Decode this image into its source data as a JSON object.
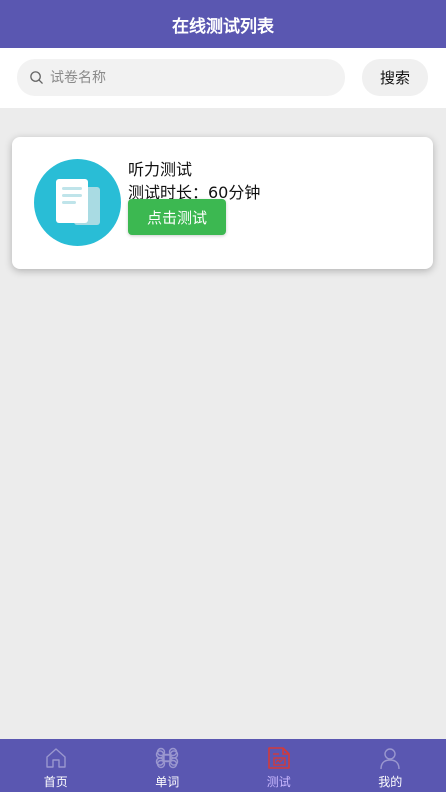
{
  "header": {
    "title": "在线测试列表"
  },
  "search": {
    "placeholder": "试卷名称",
    "value": "",
    "button_label": "搜索"
  },
  "tests": [
    {
      "title": "听力测试",
      "duration_text": "测试时长：60分钟",
      "start_label": "点击测试"
    }
  ],
  "tabbar": {
    "items": [
      {
        "label": "首页",
        "icon": "home-icon"
      },
      {
        "label": "单词",
        "icon": "command-icon"
      },
      {
        "label": "测试",
        "icon": "test-paper-icon",
        "active": true
      },
      {
        "label": "我的",
        "icon": "user-icon"
      }
    ]
  },
  "colors": {
    "primary": "#5a57b1",
    "accent_green": "#3cb851",
    "avatar_bg": "#29bdd6",
    "active_icon": "#d23a3a",
    "active_label": "#c9b8ff"
  }
}
